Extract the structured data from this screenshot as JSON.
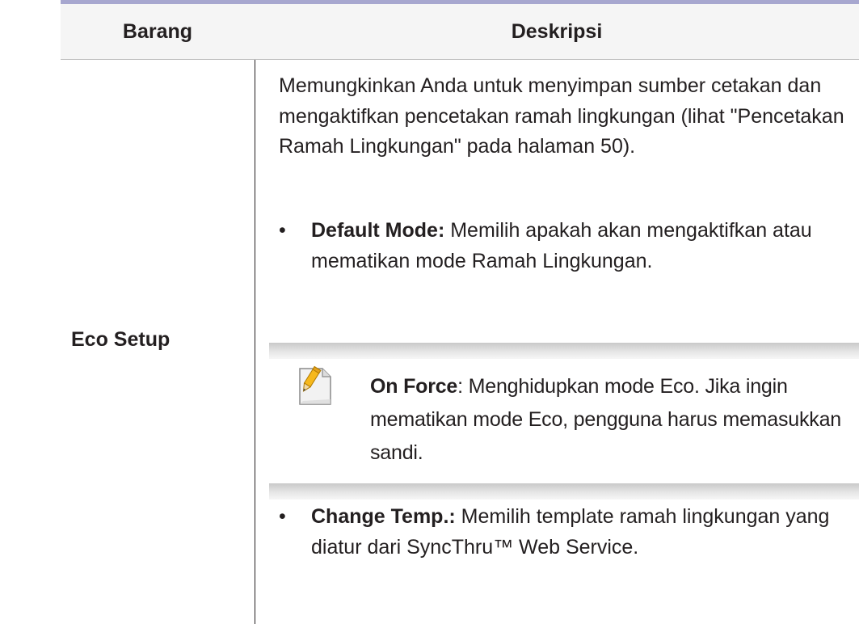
{
  "table": {
    "headers": {
      "item": "Barang",
      "description": "Deskripsi"
    },
    "rows": [
      {
        "item": "Eco Setup",
        "description": "Memungkinkan Anda untuk menyimpan sumber cetakan dan mengaktifkan pencetakan ramah lingkungan (lihat \"Pencetakan Ramah Lingkungan\" pada halaman 50).",
        "bullets": [
          {
            "term": "Default Mode:",
            "text": " Memilih apakah akan mengaktifkan atau mematikan mode Ramah Lingkungan."
          },
          {
            "term": "Change Temp.:",
            "text": " Memilih template ramah lingkungan yang diatur dari SyncThru™ Web Service."
          }
        ],
        "note": {
          "icon": "note-pencil-icon",
          "term": "On Force",
          "text": ": Menghidupkan mode Eco. Jika ingin mematikan mode Eco, pengguna harus memasukkan sandi."
        }
      }
    ]
  },
  "colors": {
    "top_rule": "#a7a7cf",
    "header_bg": "#f5f5f5"
  }
}
